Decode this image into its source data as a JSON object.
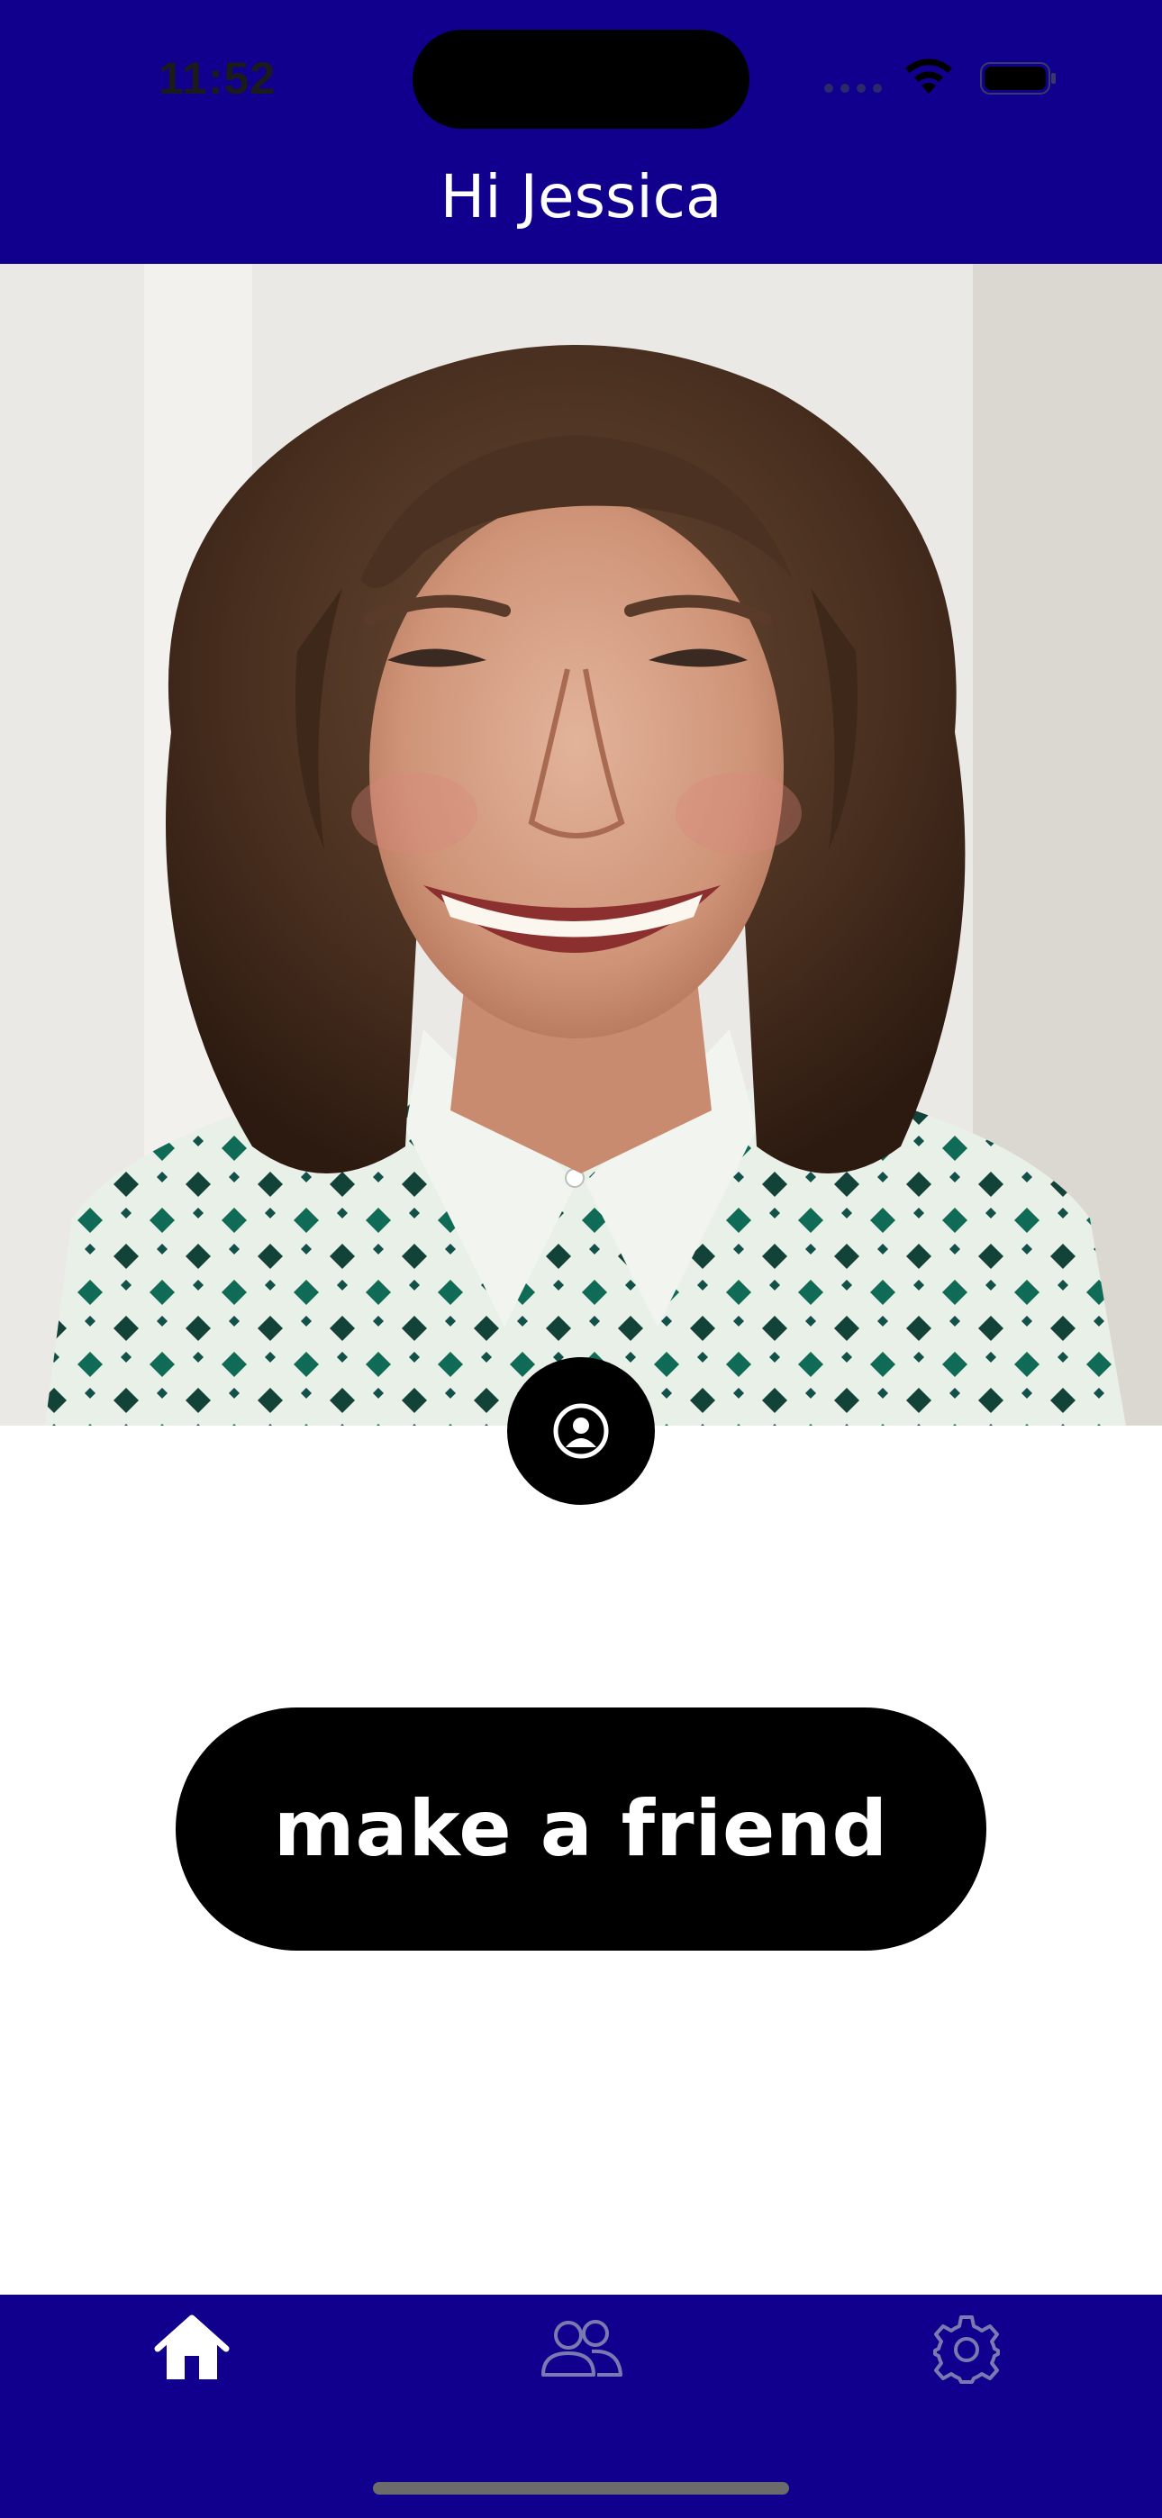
{
  "status_bar": {
    "time": "11:52"
  },
  "header": {
    "title": "Hi Jessica",
    "background": "#10008d"
  },
  "photo": {
    "alt": "Smiling woman with curly brown hair wearing a green and white patterned shirt"
  },
  "profile": {
    "icon": "person-circle-icon"
  },
  "cta": {
    "label": "make a friend"
  },
  "tabbar": {
    "background": "#10008d",
    "items": [
      {
        "name": "home",
        "icon": "house-icon",
        "active": true
      },
      {
        "name": "friends",
        "icon": "people-icon",
        "active": false
      },
      {
        "name": "settings",
        "icon": "gear-icon",
        "active": false
      }
    ]
  }
}
